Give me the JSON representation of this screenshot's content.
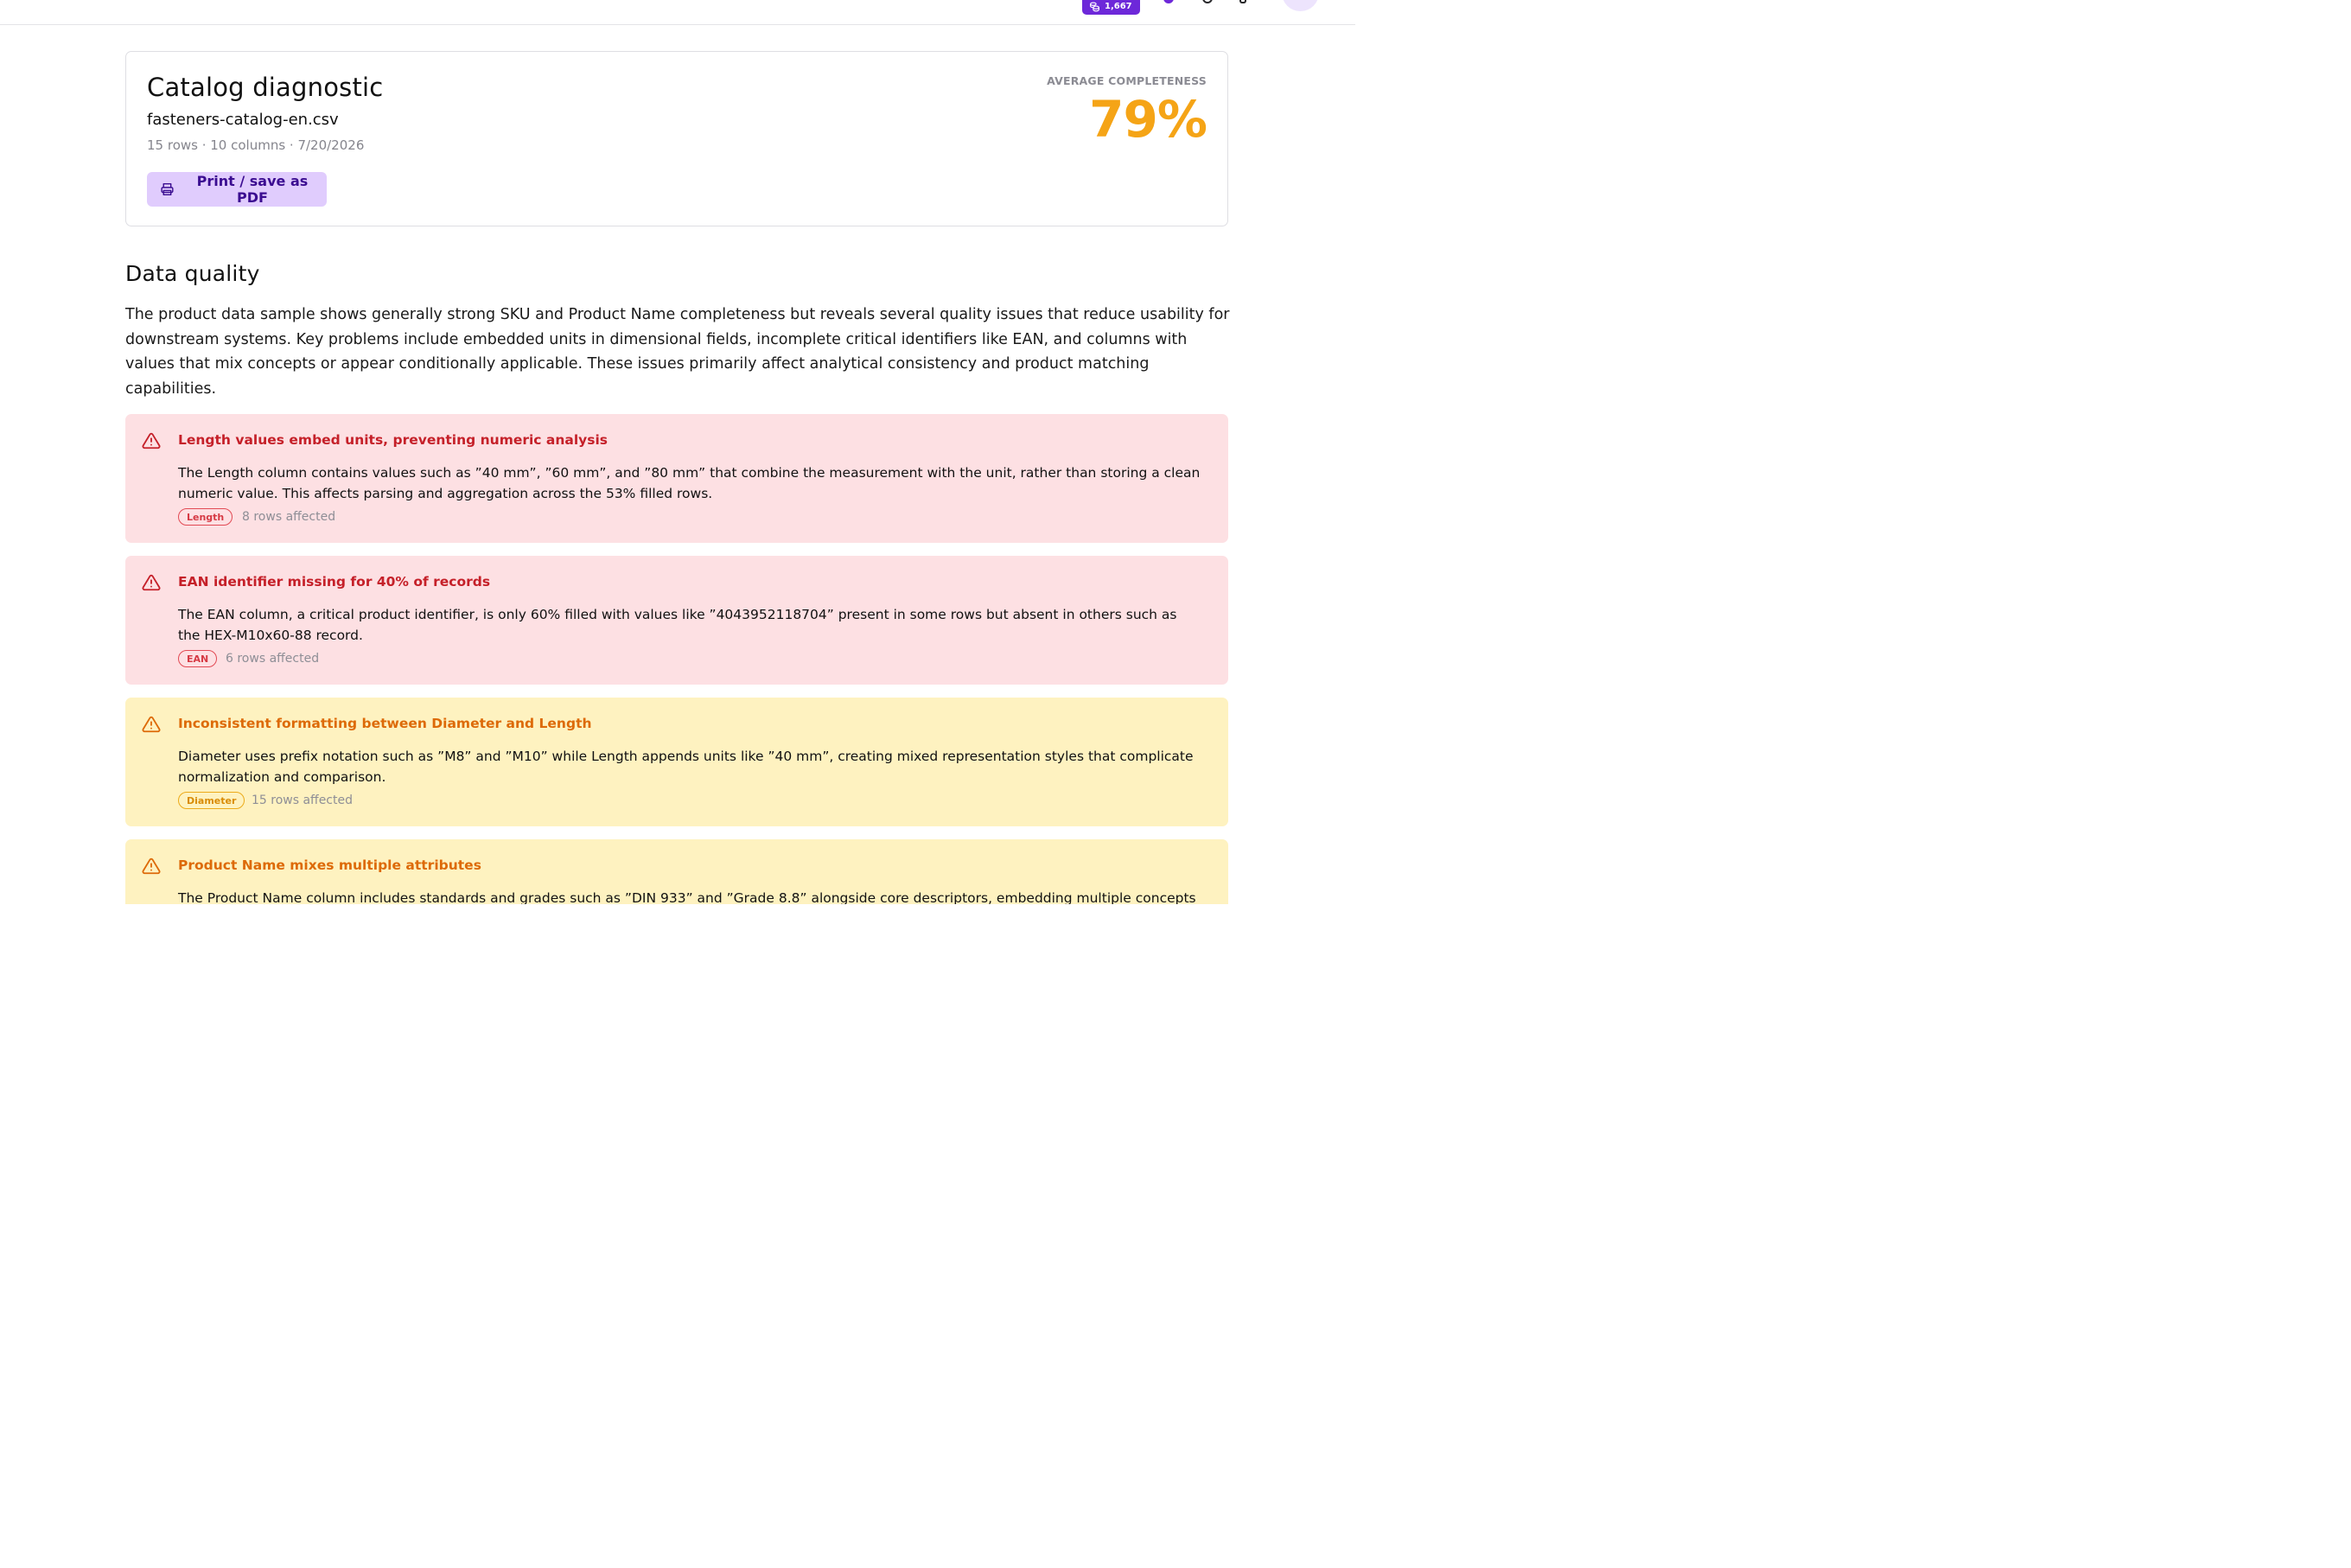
{
  "topbar": {
    "credits_count": "1,667"
  },
  "summary": {
    "title": "Catalog diagnostic",
    "filename": "fasteners-catalog-en.csv",
    "meta": "15 rows · 10 columns · 7/20/2026",
    "print_button_label": "Print / save as PDF",
    "average_completeness_label": "AVERAGE COMPLETENESS",
    "average_completeness_value": "79%"
  },
  "data_quality": {
    "title": "Data quality",
    "description": "The product data sample shows generally strong SKU and Product Name completeness but reveals several quality issues that reduce usability for downstream systems. Key problems include embedded units in dimensional fields, incomplete critical identifiers like EAN, and columns with values that mix concepts or appear conditionally applicable. These issues primarily affect analytical consistency and product matching capabilities.",
    "issues": [
      {
        "severity": "high",
        "title": "Length values embed units, preventing numeric analysis",
        "description": "The Length column contains values such as ”40 mm”, ”60 mm”, and ”80 mm” that combine the measurement with the unit, rather than storing a clean numeric value. This affects parsing and aggregation across the 53% filled rows.",
        "column": "Length",
        "affected": "8 rows affected"
      },
      {
        "severity": "high",
        "title": "EAN identifier missing for 40% of records",
        "description": "The EAN column, a critical product identifier, is only 60% filled with values like ”4043952118704” present in some rows but absent in others such as the HEX-M10x60-88 record.",
        "column": "EAN",
        "affected": "6 rows affected"
      },
      {
        "severity": "medium",
        "title": "Inconsistent formatting between Diameter and Length",
        "description": "Diameter uses prefix notation such as ”M8” and ”M10” while Length appends units like ”40 mm”, creating mixed representation styles that complicate normalization and comparison.",
        "column": "Diameter",
        "affected": "15 rows affected"
      },
      {
        "severity": "medium",
        "title": "Product Name mixes multiple attributes",
        "description": "The Product Name column includes standards and grades such as ”DIN 933” and ”Grade 8.8” alongside core descriptors, embedding multiple concepts"
      }
    ]
  },
  "colors": {
    "brand": "#6d28d9",
    "accent_orange": "#f5a416",
    "high_bg": "#fde0e3",
    "high_text": "#c52029",
    "medium_bg": "#fef2c0",
    "medium_text": "#dd6a08"
  }
}
